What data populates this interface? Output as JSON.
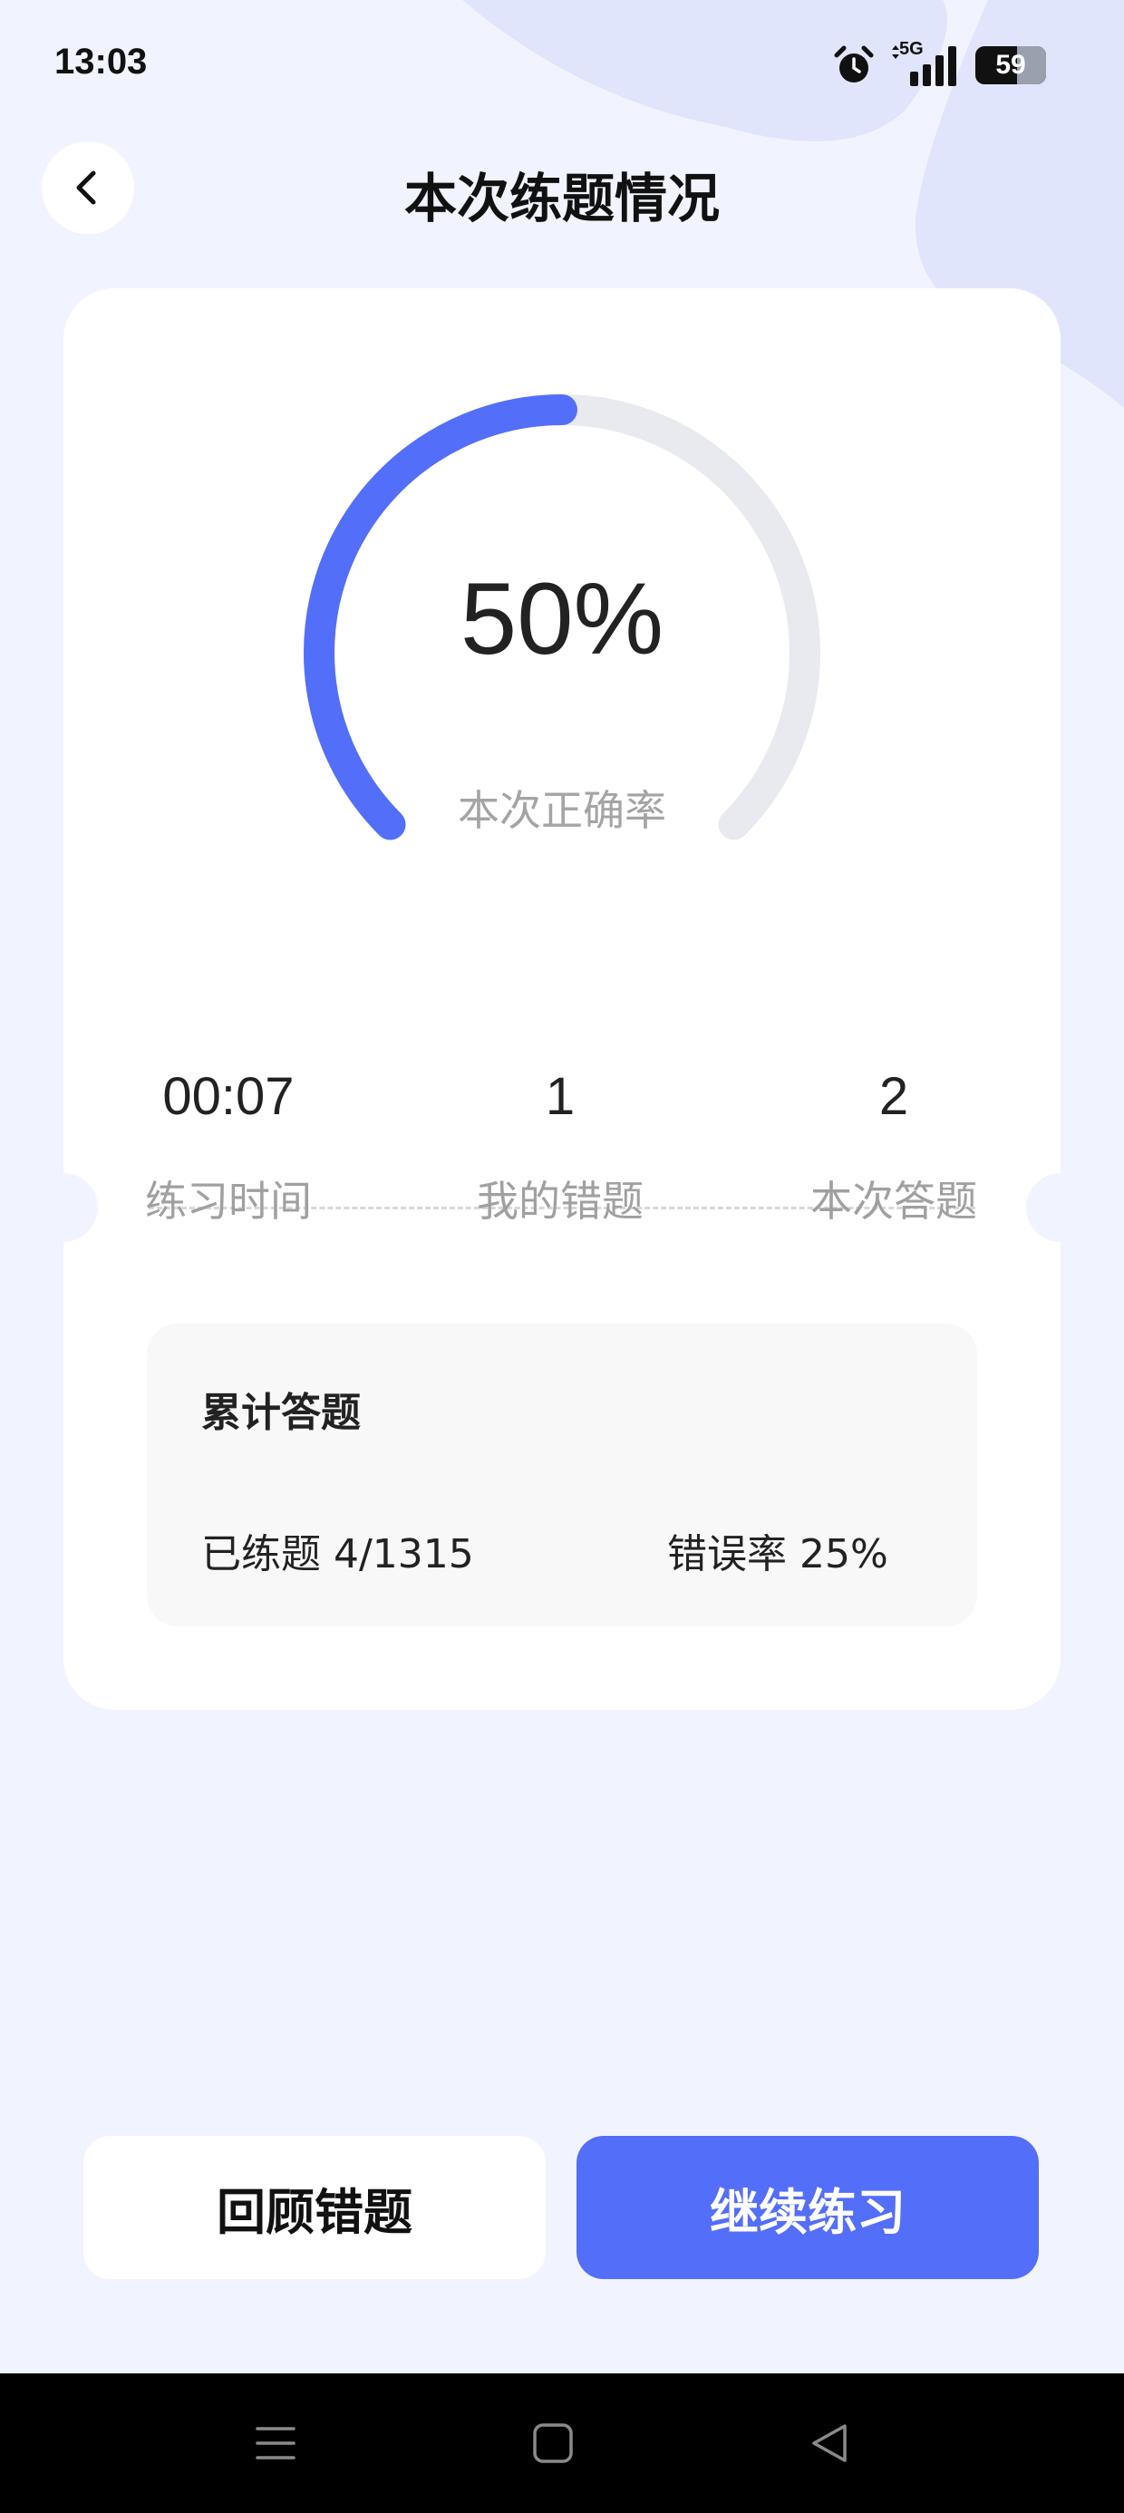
{
  "status_bar": {
    "time": "13:03",
    "network": "5G",
    "battery": "59",
    "battery_level": 0.59,
    "icons": [
      "alarm-icon",
      "network-5g-icon",
      "signal-icon",
      "battery-icon"
    ]
  },
  "header": {
    "title": "本次练题情况",
    "back_icon": "chevron-left-icon"
  },
  "summary": {
    "accuracy_value": "50%",
    "accuracy_fraction": 0.5,
    "accuracy_label": "本次正确率"
  },
  "stats": [
    {
      "value": "00:07",
      "label": "练习时间"
    },
    {
      "value": "1",
      "label": "我的错题"
    },
    {
      "value": "2",
      "label": "本次答题"
    }
  ],
  "cumulative": {
    "title": "累计答题",
    "practiced": "已练题 4/1315",
    "error_rate": "错误率 25%"
  },
  "actions": {
    "review_label": "回顾错题",
    "continue_label": "继续练习"
  },
  "system_nav": [
    "menu-icon",
    "home-icon",
    "back-triangle-icon"
  ],
  "colors": {
    "accent": "#536ef8",
    "page_background": "#f1f4fe",
    "track": "#e9eaef"
  }
}
